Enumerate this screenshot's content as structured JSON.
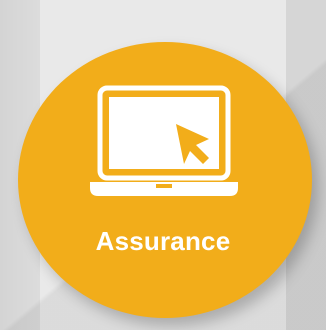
{
  "badge": {
    "label": "Assurance",
    "icon": "laptop-cursor-icon",
    "color": "#f2ad1a",
    "text_color": "#ffffff"
  },
  "background": {
    "color": "#e9e9e9"
  }
}
